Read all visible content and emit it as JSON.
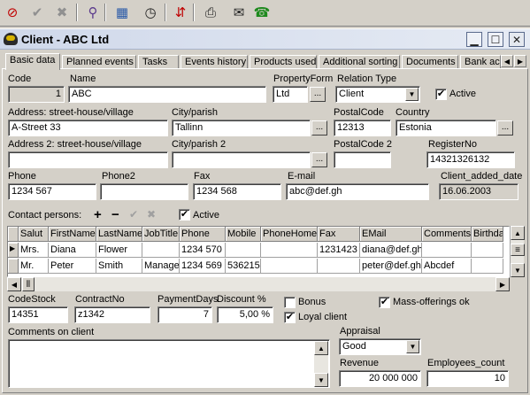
{
  "window": {
    "title": "Client - ABC Ltd",
    "buttons": {
      "minimize": "▁",
      "maximize": "☐",
      "close": "✕"
    }
  },
  "toolbar": {
    "items": [
      {
        "name": "delete-icon",
        "glyph": "⊘",
        "color": "#c00000"
      },
      {
        "name": "confirm-icon",
        "glyph": "✔",
        "color": "#909090"
      },
      {
        "name": "cancel-icon",
        "glyph": "✖",
        "color": "#909090"
      },
      {
        "name": "filter-icon",
        "glyph": "⚲",
        "color": "#5b3a8c"
      },
      {
        "name": "calendar-icon",
        "glyph": "▦",
        "color": "#2a5aa8"
      },
      {
        "name": "clock-icon",
        "glyph": "◷",
        "color": "#202020"
      },
      {
        "name": "transfer-icon",
        "glyph": "⇵",
        "color": "#c00000"
      },
      {
        "name": "print-icon",
        "glyph": "⎙",
        "color": "#202020"
      },
      {
        "name": "email-icon",
        "glyph": "✉",
        "color": "#202020"
      },
      {
        "name": "phone-icon",
        "glyph": "☎",
        "color": "#1e8a1e"
      }
    ]
  },
  "tabs": [
    "Basic data",
    "Planned events",
    "Tasks",
    "Events history",
    "Products used",
    "Additional sorting",
    "Documents",
    "Bank ac"
  ],
  "tab_scroll": {
    "left": "◀",
    "right": "▶"
  },
  "form": {
    "code": {
      "label": "Code",
      "value": "1"
    },
    "name": {
      "label": "Name",
      "value": "ABC"
    },
    "property_form": {
      "label": "PropertyForm",
      "value": "Ltd",
      "button": "..."
    },
    "relation_type": {
      "label": "Relation Type",
      "value": "Client"
    },
    "active": {
      "label": "Active",
      "checked": true
    },
    "address": {
      "label": "Address: street-house/village",
      "value": "A-Street 33"
    },
    "city": {
      "label": "City/parish",
      "value": "Tallinn",
      "button": "..."
    },
    "postal_code": {
      "label": "PostalCode",
      "value": "12313"
    },
    "country": {
      "label": "Country",
      "value": "Estonia",
      "button": "..."
    },
    "address2": {
      "label": "Address 2: street-house/village",
      "value": ""
    },
    "city2": {
      "label": "City/parish 2",
      "value": "",
      "button": "..."
    },
    "postal_code2": {
      "label": "PostalCode 2",
      "value": ""
    },
    "register_no": {
      "label": "RegisterNo",
      "value": "14321326132"
    },
    "phone": {
      "label": "Phone",
      "value": "1234 567"
    },
    "phone2": {
      "label": "Phone2",
      "value": ""
    },
    "fax": {
      "label": "Fax",
      "value": "1234 568"
    },
    "email": {
      "label": "E-mail",
      "value": "abc@def.gh"
    },
    "client_added_date": {
      "label": "Client_added_date",
      "value": "16.06.2003"
    }
  },
  "contacts": {
    "label": "Contact persons:",
    "tools": {
      "add": "+",
      "remove": "−",
      "confirm": "✔",
      "cancel": "✖"
    },
    "active": {
      "label": "Active",
      "checked": true
    },
    "columns": [
      "Salut",
      "FirstName",
      "LastName",
      "JobTitle",
      "Phone",
      "Mobile",
      "PhoneHome",
      "Fax",
      "EMail",
      "Comments",
      "Birthda"
    ],
    "rows": [
      [
        "Mrs.",
        "Diana",
        "Flower",
        "",
        "1234 570",
        "",
        "",
        "1231423",
        "diana@def.gh",
        "",
        ""
      ],
      [
        "Mr.",
        "Peter",
        "Smith",
        "Manage",
        "1234 569",
        "536215",
        "",
        "",
        "peter@def.gh",
        "Abcdef",
        ""
      ]
    ],
    "current_row_marker": "▶"
  },
  "bottom": {
    "code_stock": {
      "label": "CodeStock",
      "value": "14351"
    },
    "contract_no": {
      "label": "ContractNo",
      "value": "z1342"
    },
    "payment_days": {
      "label": "PaymentDays",
      "value": "7"
    },
    "discount": {
      "label": "Discount %",
      "value": "5,00 %"
    },
    "bonus": {
      "label": "Bonus",
      "checked": false
    },
    "mass_offerings": {
      "label": "Mass-offerings ok",
      "checked": true
    },
    "loyal_client": {
      "label": "Loyal client",
      "checked": true
    },
    "comments": {
      "label": "Comments on client",
      "value": ""
    },
    "appraisal": {
      "label": "Appraisal",
      "value": "Good"
    },
    "revenue": {
      "label": "Revenue",
      "value": "20 000 000"
    },
    "employees": {
      "label": "Employees_count",
      "value": "10"
    }
  }
}
